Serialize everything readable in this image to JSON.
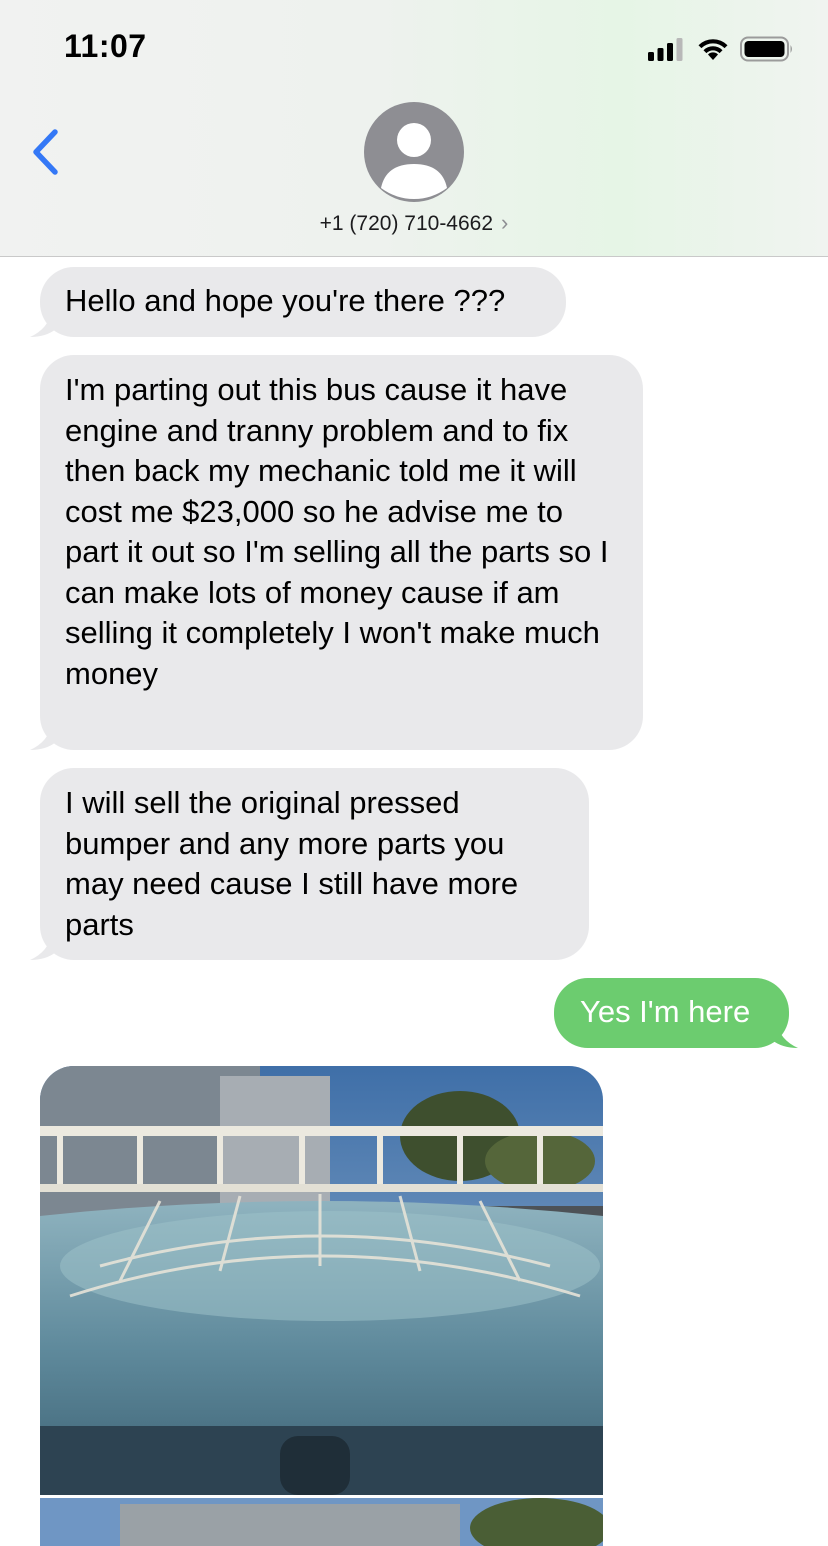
{
  "status_bar": {
    "time": "11:07",
    "signal_icon": "cellular-signal-icon",
    "wifi_icon": "wifi-icon",
    "battery_icon": "battery-icon"
  },
  "header": {
    "back_icon": "chevron-left-icon",
    "avatar_icon": "person-silhouette-icon",
    "contact": "+1 (720) 710-4662",
    "contact_chevron": "›"
  },
  "colors": {
    "accent": "#3478f6",
    "incoming_bubble": "#e9e9eb",
    "outgoing_bubble": "#6ccc6f"
  },
  "messages": [
    {
      "direction": "incoming",
      "text": "Hello and hope you're there ???"
    },
    {
      "direction": "incoming",
      "text": "I'm parting out this bus cause it have engine and tranny problem and to fix then back my mechanic told me it will cost me $23,000 so he advise me to part it out so I'm selling all the parts so I can make lots of money cause if am selling it completely I won't make much money"
    },
    {
      "direction": "incoming",
      "text": "I will sell the original pressed bumper and any more parts you may need cause I still have more parts"
    },
    {
      "direction": "outgoing",
      "text": "Yes I'm here"
    },
    {
      "direction": "incoming",
      "type": "photo",
      "description_icon": "photo-roof-rack"
    },
    {
      "direction": "incoming",
      "type": "photo",
      "description_icon": "photo-partial"
    }
  ]
}
